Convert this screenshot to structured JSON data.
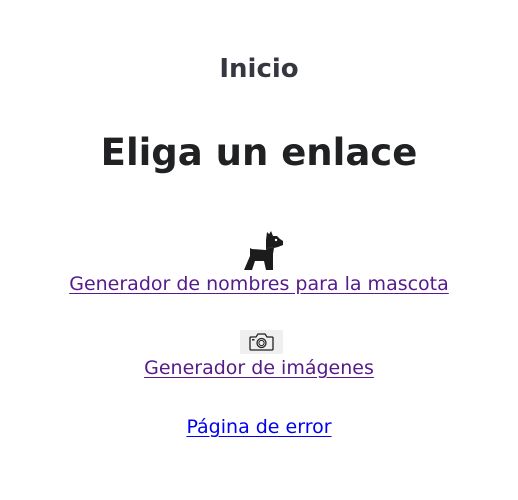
{
  "nav": {
    "home_label": "Inicio"
  },
  "main": {
    "title": "Eliga un enlace",
    "links": [
      {
        "label": "Generador de nombres para la mascota",
        "icon": "dog-icon",
        "color": "#551a8b"
      },
      {
        "label": "Generador de imágenes",
        "icon": "camera-icon",
        "color": "#551a8b"
      },
      {
        "label": "Página de error",
        "icon": "",
        "color": "#0000ee"
      }
    ]
  }
}
